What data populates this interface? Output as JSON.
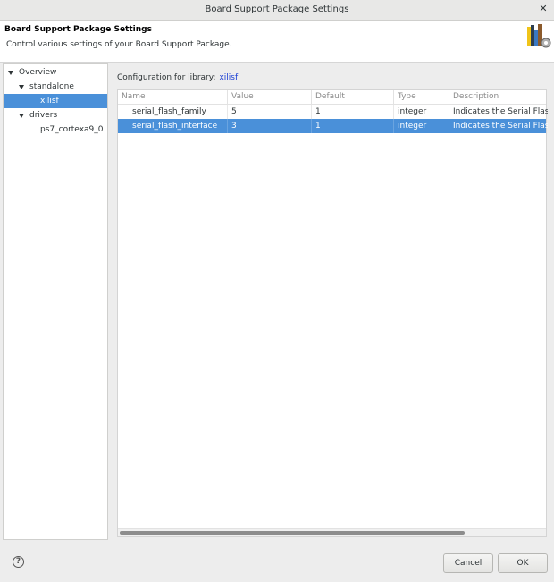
{
  "window": {
    "title": "Board Support Package Settings"
  },
  "header": {
    "title": "Board Support Package Settings",
    "description": "Control various settings of your Board Support Package."
  },
  "tree": {
    "items": [
      {
        "label": "Overview"
      },
      {
        "label": "standalone"
      },
      {
        "label": "xilisf"
      },
      {
        "label": "drivers"
      },
      {
        "label": "ps7_cortexa9_0"
      }
    ]
  },
  "config": {
    "label": "Configuration for library:",
    "library": "xilisf"
  },
  "table": {
    "columns": [
      "Name",
      "Value",
      "Default",
      "Type",
      "Description"
    ],
    "rows": [
      {
        "name": "serial_flash_family",
        "value": "5",
        "default": "1",
        "type": "integer",
        "description": "Indicates the Serial Flash f"
      },
      {
        "name": "serial_flash_interface",
        "value": "3",
        "default": "1",
        "type": "integer",
        "description": "Indicates the Serial Flash i"
      }
    ]
  },
  "footer": {
    "help": "?",
    "cancel": "Cancel",
    "ok": "OK"
  },
  "colors": {
    "selection": "#4a90d9",
    "link": "#1a3ed5"
  },
  "icons": [
    "close-icon",
    "bsp-books-icon",
    "help-icon",
    "expand-triangle-icon"
  ]
}
